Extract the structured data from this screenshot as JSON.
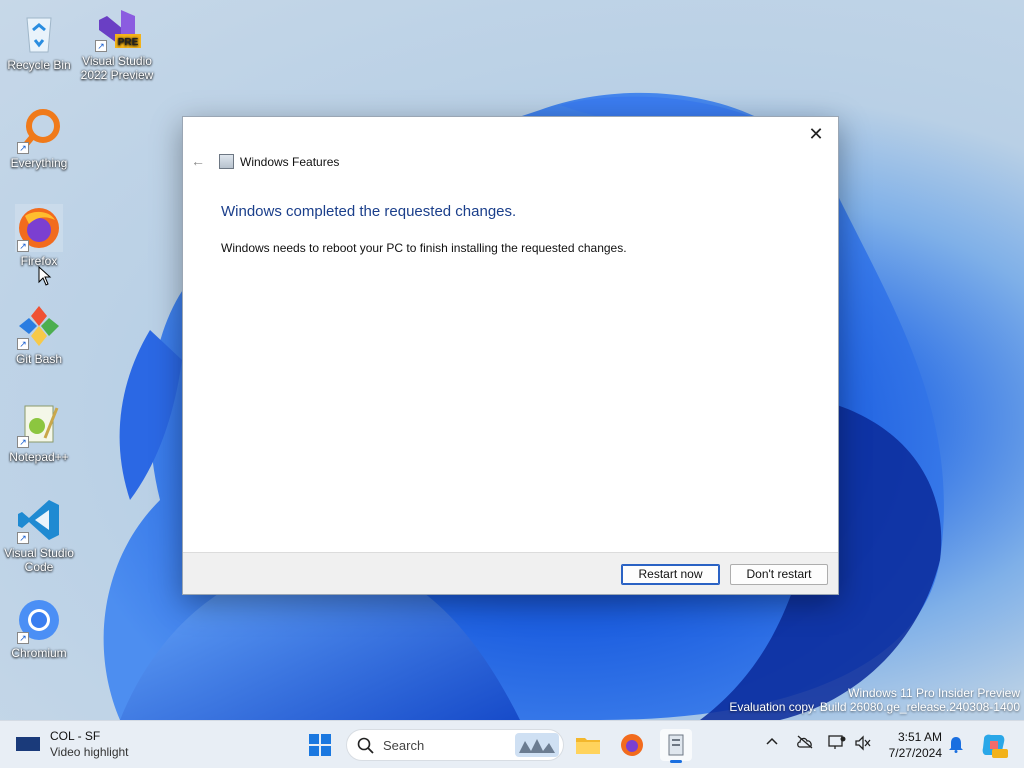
{
  "desktop": {
    "icons": [
      {
        "label": "Recycle Bin",
        "icon": "recycle-bin-icon"
      },
      {
        "label": "Visual Studio 2022 Preview",
        "icon": "visual-studio-preview-icon",
        "badge": "PRE"
      },
      {
        "label": "Everything",
        "icon": "everything-search-icon"
      },
      {
        "label": "Firefox",
        "icon": "firefox-icon"
      },
      {
        "label": "Git Bash",
        "icon": "git-bash-icon"
      },
      {
        "label": "Notepad++",
        "icon": "notepad-plus-plus-icon"
      },
      {
        "label": "Visual Studio Code",
        "icon": "vscode-icon"
      },
      {
        "label": "Chromium",
        "icon": "chromium-icon"
      }
    ]
  },
  "dialog": {
    "title": "Windows Features",
    "heading": "Windows completed the requested changes.",
    "message": "Windows needs to reboot your PC to finish installing the requested changes.",
    "buttons": {
      "restart": "Restart now",
      "dont_restart": "Don't restart"
    },
    "close_glyph": "✕",
    "back_glyph": "←"
  },
  "watermark": {
    "line1": "Windows 11 Pro Insider Preview",
    "line2": "Evaluation copy. Build 26080.ge_release.240308-1400"
  },
  "taskbar": {
    "weather": {
      "line1": "COL - SF",
      "line2": "Video highlight"
    },
    "search_placeholder": "Search",
    "clock": {
      "time": "3:51 AM",
      "date": "7/27/2024"
    }
  },
  "colors": {
    "accent": "#1a6fe0",
    "heading": "#1b3f8b"
  }
}
